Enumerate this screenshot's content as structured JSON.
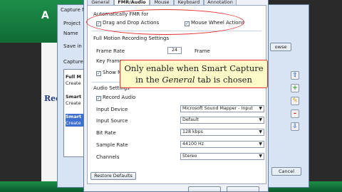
{
  "background": {
    "logo": "A",
    "rec_text": "Rec"
  },
  "capture_manager": {
    "title": "Capture Man",
    "labels": {
      "project": "Project",
      "name": "Name",
      "save_in": "Save in",
      "captures": "Capture"
    },
    "browse_label": "owse",
    "list_items": [
      {
        "title": "Full M",
        "sub": "Create"
      },
      {
        "title": "Smart",
        "sub": "Create"
      },
      {
        "title": "Smart",
        "sub": "Create"
      }
    ],
    "cancel_label": "Cancel",
    "colors": {
      "add": "#2f9a2f",
      "remove": "#cc2a2a",
      "edit": "#d9a21b",
      "up": "#3d6fd0"
    }
  },
  "prefs": {
    "tabs": [
      "General",
      "FMR/Audio",
      "Mouse",
      "Keyboard",
      "Annotation"
    ],
    "active_tab": "FMR/Audio",
    "auto_fmr_label": "Automatically FMR for",
    "drag_drop": {
      "label": "Drag and Drop Actions",
      "checked": true
    },
    "mouse_wheel": {
      "label": "Mouse Wheel Actions",
      "checked": true
    },
    "fmr_settings_label": "Full Motion Recording Settings",
    "frame_rate": {
      "label": "Frame Rate",
      "value": "24",
      "unit": "Frame"
    },
    "key_frames_label": "Key Frames",
    "show_mouse": {
      "label": "Show M",
      "checked": true
    },
    "audio_settings_label": "Audio Settings",
    "record_audio": {
      "label": "Record Audio",
      "checked": true
    },
    "fields": [
      {
        "label": "Input Device",
        "value": "Microsoft Sound Mapper - Input"
      },
      {
        "label": "Input Source",
        "value": "Default"
      },
      {
        "label": "Bit Rate",
        "value": "128 kbps"
      },
      {
        "label": "Sample Rate",
        "value": "44100 Hz"
      },
      {
        "label": "Channels",
        "value": "Stereo"
      }
    ],
    "restore_label": "Restore Defaults"
  },
  "callout": {
    "line1": "Only enable when Smart Capture",
    "line2_pre": "in the ",
    "line2_em": "General",
    "line2_post": " tab is chosen",
    "accent": "#e03030"
  }
}
